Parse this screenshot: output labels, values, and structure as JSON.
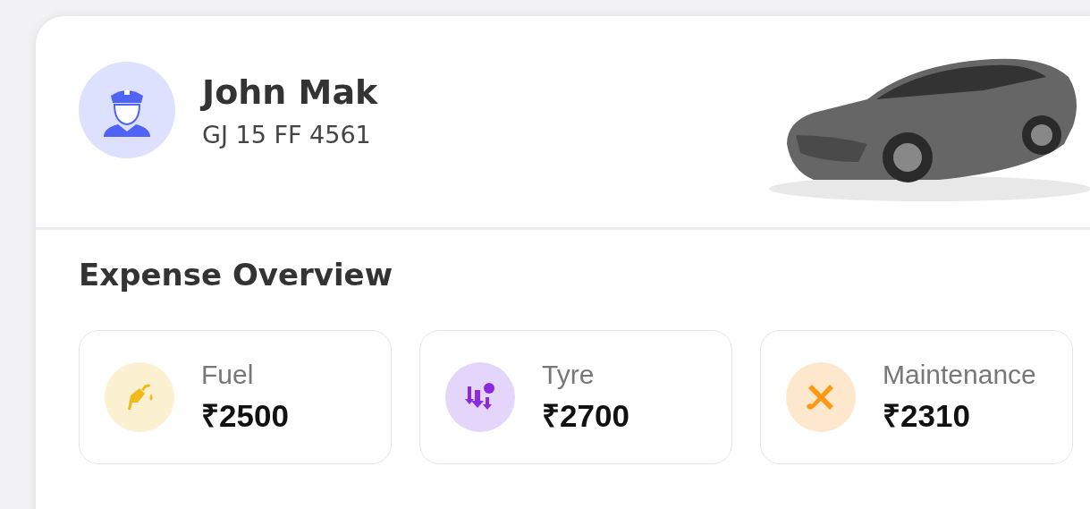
{
  "driver": {
    "name": "John Mak",
    "plate": "GJ 15 FF 4561"
  },
  "expenses": {
    "title": "Expense Overview",
    "items": [
      {
        "kind": "fuel",
        "label": "Fuel",
        "amount": "₹2500"
      },
      {
        "kind": "tyre",
        "label": "Tyre",
        "amount": "₹2700"
      },
      {
        "kind": "maintenance",
        "label": "Maintenance",
        "amount": "₹2310"
      }
    ]
  }
}
